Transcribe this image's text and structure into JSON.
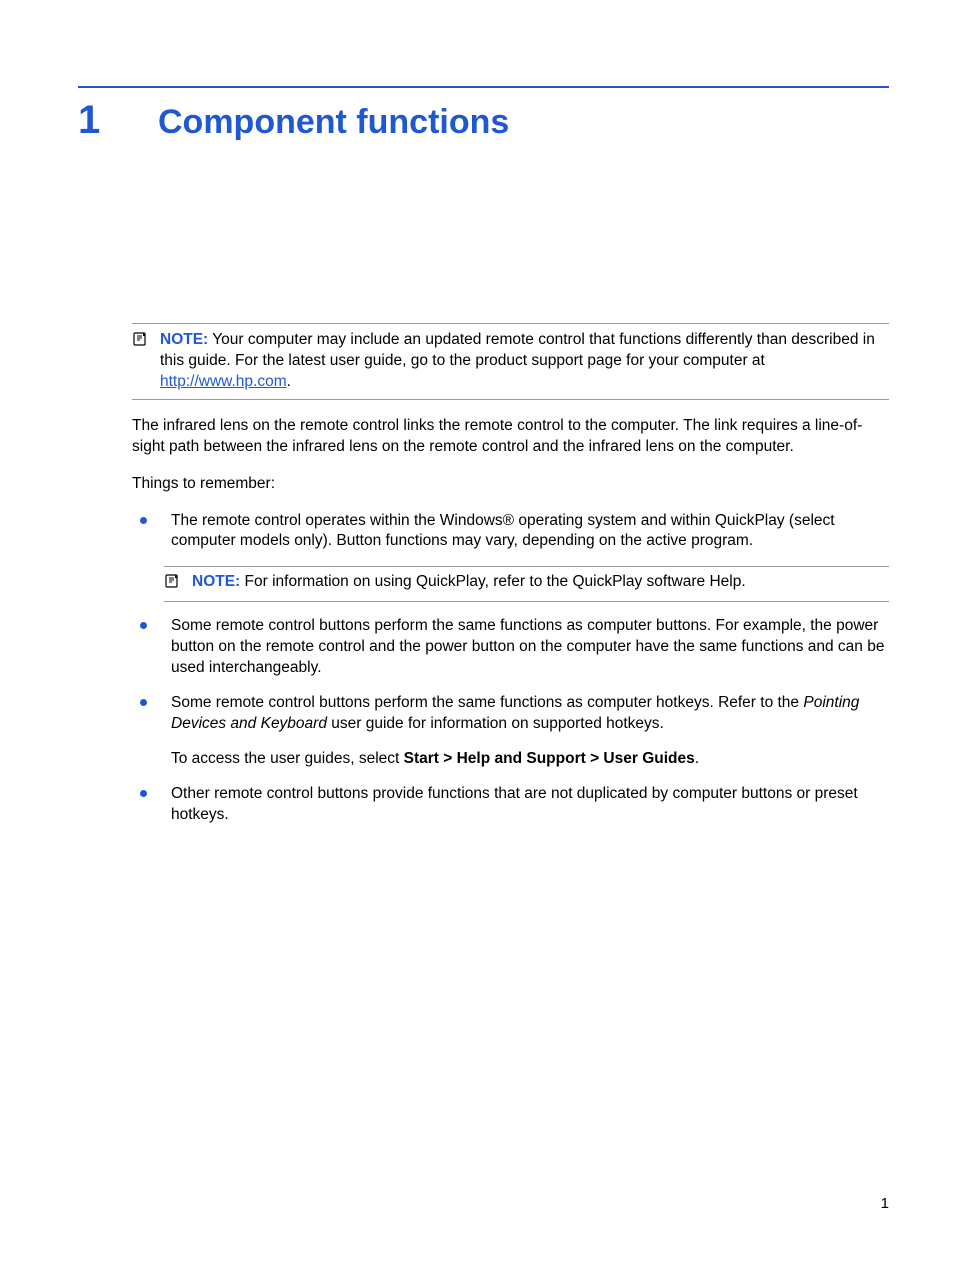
{
  "chapter": {
    "number": "1",
    "title": "Component functions"
  },
  "note1": {
    "label": "NOTE:",
    "text_before_link": "Your computer may include an updated remote control that functions differently than described in this guide. For the latest user guide, go to the product support page for your computer at ",
    "link_text": "http://www.hp.com",
    "text_after_link": "."
  },
  "para_infrared": "The infrared lens on the remote control links the remote control to the computer. The link requires a line-of-sight path between the infrared lens on the remote control and the infrared lens on the computer.",
  "para_remember": "Things to remember:",
  "bullets": {
    "b1": "The remote control operates within the Windows® operating system and within QuickPlay (select computer models only). Button functions may vary, depending on the active program.",
    "b2": "Some remote control buttons perform the same functions as computer buttons. For example, the power button on the remote control and the power button on the computer have the same functions and can be used interchangeably.",
    "b3_pre": "Some remote control buttons perform the same functions as computer hotkeys. Refer to the ",
    "b3_italic": "Pointing Devices and Keyboard",
    "b3_post": " user guide for information on supported hotkeys.",
    "b3_sub_pre": "To access the user guides, select ",
    "b3_sub_bold": "Start > Help and Support > User Guides",
    "b3_sub_post": ".",
    "b4": "Other remote control buttons provide functions that are not duplicated by computer buttons or preset hotkeys."
  },
  "nested_note": {
    "label": "NOTE:",
    "text": "For information on using QuickPlay, refer to the QuickPlay software Help."
  },
  "page_number": "1"
}
